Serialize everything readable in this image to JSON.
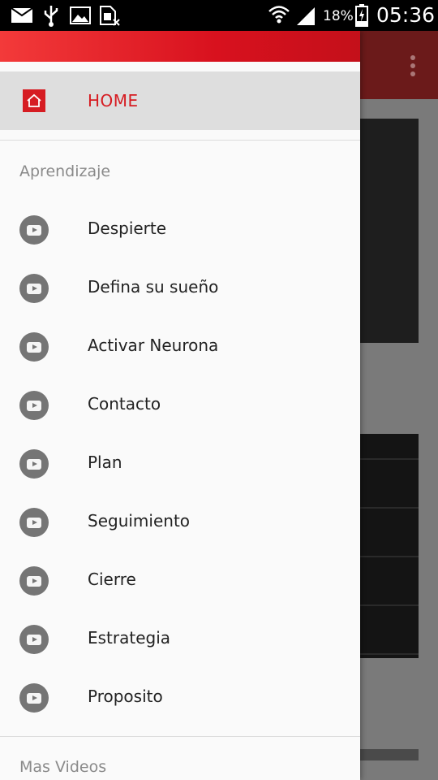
{
  "status_bar": {
    "battery": "18%",
    "time": "05:36",
    "icons": [
      "mail-icon",
      "usb-icon",
      "image-icon",
      "sim-card-icon",
      "wifi-icon",
      "signal-icon",
      "battery-charging-icon"
    ]
  },
  "background_app": {
    "menu_icon": "overflow-menu-icon"
  },
  "drawer": {
    "home": {
      "label": "HOME",
      "icon": "home-icon"
    },
    "sections": [
      {
        "header": "Aprendizaje",
        "items": [
          {
            "label": "Despierte",
            "icon": "play-circle-icon"
          },
          {
            "label": "Defina su sueño",
            "icon": "play-circle-icon"
          },
          {
            "label": "Activar Neurona",
            "icon": "play-circle-icon"
          },
          {
            "label": "Contacto",
            "icon": "play-circle-icon"
          },
          {
            "label": "Plan",
            "icon": "play-circle-icon"
          },
          {
            "label": "Seguimiento",
            "icon": "play-circle-icon"
          },
          {
            "label": "Cierre",
            "icon": "play-circle-icon"
          },
          {
            "label": "Estrategia",
            "icon": "play-circle-icon"
          },
          {
            "label": "Proposito",
            "icon": "play-circle-icon"
          }
        ]
      },
      {
        "header": "Mas Videos",
        "items": []
      }
    ]
  },
  "colors": {
    "accent": "#d61c22",
    "header_gradient_start": "#f33a3a",
    "header_gradient_end": "#c4101a",
    "selected_bg": "#dedede",
    "icon_gray": "#757575"
  }
}
